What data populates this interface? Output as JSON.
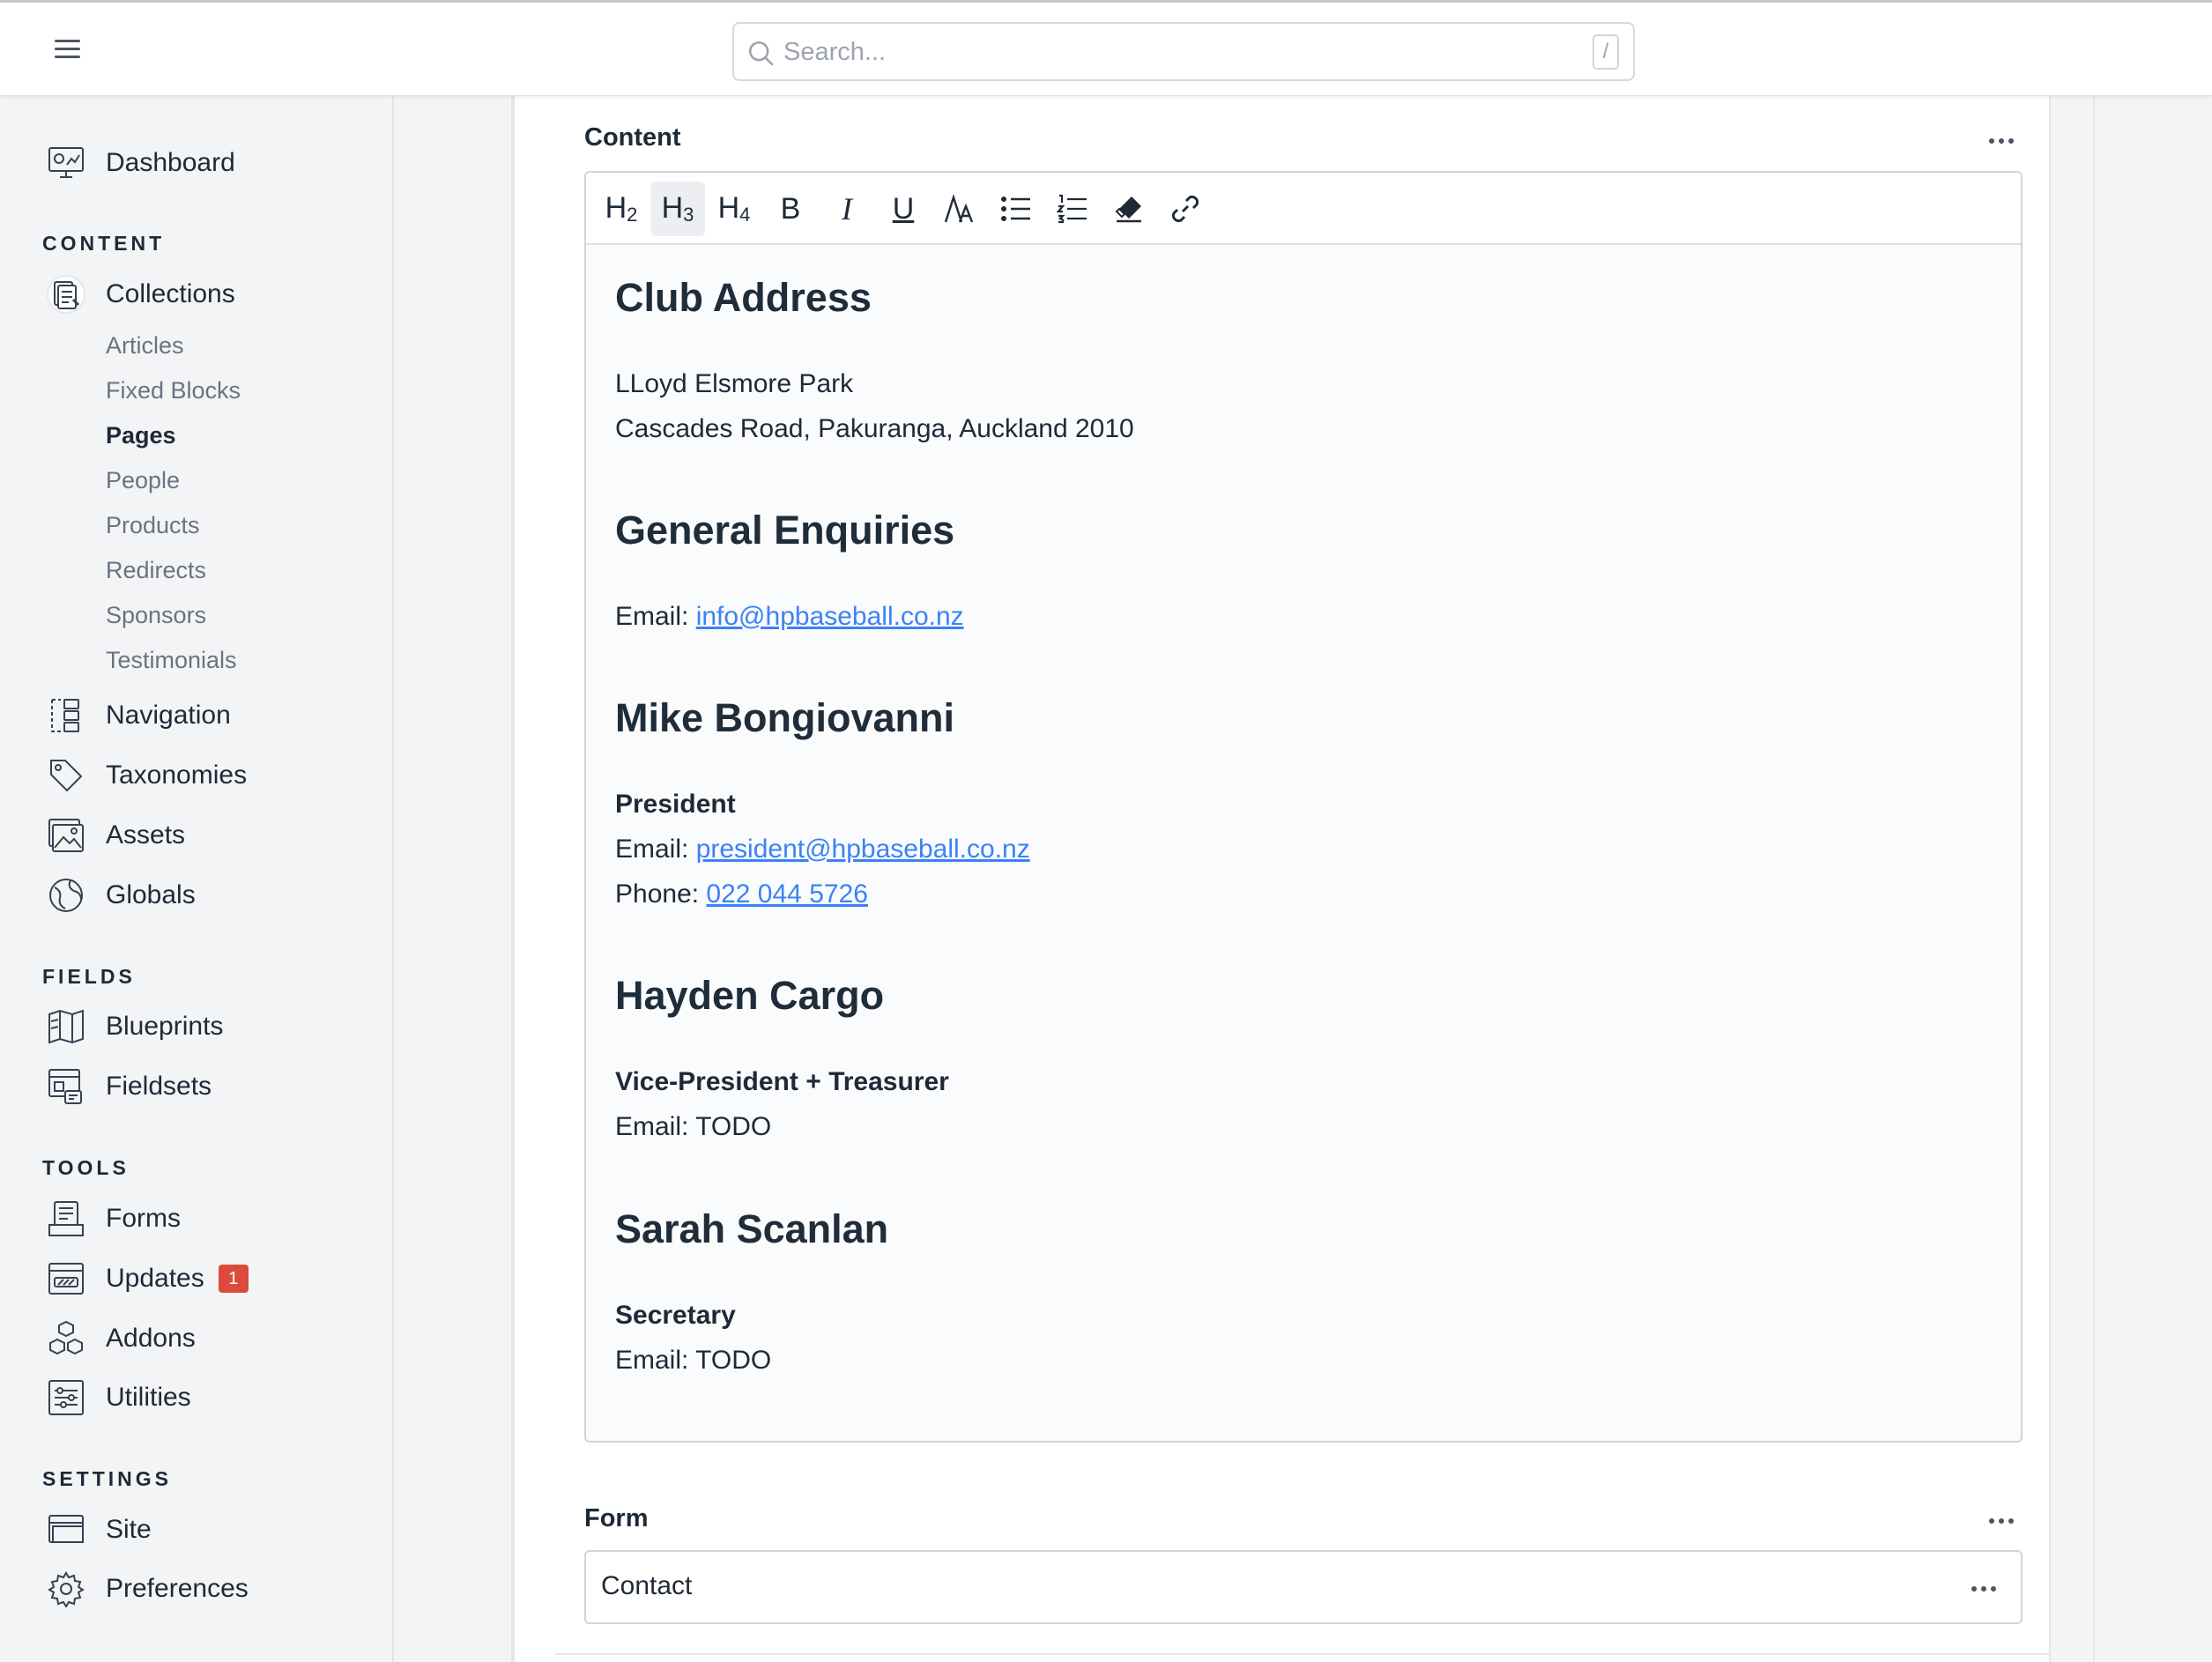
{
  "search": {
    "placeholder": "Search...",
    "shortcut": "/"
  },
  "sidebar": {
    "dashboard": "Dashboard",
    "sections": {
      "content": "CONTENT",
      "fields": "FIELDS",
      "tools": "TOOLS",
      "settings": "SETTINGS"
    },
    "content_items": {
      "collections": "Collections",
      "navigation": "Navigation",
      "taxonomies": "Taxonomies",
      "assets": "Assets",
      "globals": "Globals"
    },
    "collections_sub": [
      "Articles",
      "Fixed Blocks",
      "Pages",
      "People",
      "Products",
      "Redirects",
      "Sponsors",
      "Testimonials"
    ],
    "active_sub": "Pages",
    "fields_items": {
      "blueprints": "Blueprints",
      "fieldsets": "Fieldsets"
    },
    "tools_items": {
      "forms": "Forms",
      "updates": "Updates",
      "updates_badge": "1",
      "addons": "Addons",
      "utilities": "Utilities"
    },
    "settings_items": {
      "site": "Site",
      "preferences": "Preferences"
    }
  },
  "content_field": {
    "label": "Content",
    "toolbar": {
      "h2": "H",
      "h2_sub": "2",
      "h3": "H",
      "h3_sub": "3",
      "h4": "H",
      "h4_sub": "4",
      "bold": "B",
      "italic": "I",
      "underline": "U"
    },
    "body": {
      "club_heading": "Club Address",
      "club_line1": "LLoyd Elsmore Park",
      "club_line2": "Cascades Road, Pakuranga, Auckland 2010",
      "general_heading": "General Enquiries",
      "general_email_label": "Email: ",
      "general_email": "info@hpbaseball.co.nz",
      "mike_heading": "Mike Bongiovanni",
      "mike_role": "President",
      "mike_email_label": "Email: ",
      "mike_email": "president@hpbaseball.co.nz",
      "mike_phone_label": "Phone: ",
      "mike_phone": "022 044 5726",
      "hayden_heading": "Hayden Cargo",
      "hayden_role": "Vice-President + Treasurer",
      "hayden_email": "Email: TODO",
      "sarah_heading": "Sarah Scanlan",
      "sarah_role": "Secretary",
      "sarah_email": "Email: TODO"
    }
  },
  "form_field": {
    "label": "Form",
    "value": "Contact"
  },
  "colors": {
    "link": "#3b82f6",
    "badge": "#dc4a3d",
    "text": "#1f2937",
    "muted": "#6b7280"
  }
}
